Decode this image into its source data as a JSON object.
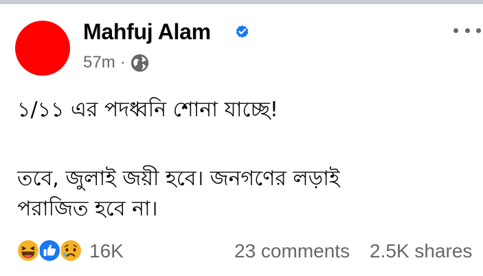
{
  "post": {
    "author": "Mahfuj Alam",
    "time": "57m",
    "separator": "·",
    "audience_icon": "globe-icon",
    "verified_icon": "verified-badge-icon",
    "more_icon": "more-options-icon",
    "lines": [
      "১/১১ এর পদধ্বনি শোনা যাচ্ছে!",
      "তবে, জুলাই জয়ী হবে। জনগণের লড়াই",
      "পরাজিত হবে না।"
    ]
  },
  "engagement": {
    "reaction_icons": [
      "haha-icon",
      "like-icon",
      "sad-icon"
    ],
    "reaction_count": "16K",
    "comments": "23 comments",
    "shares": "2.5K shares"
  },
  "colors": {
    "avatar": "#ff0000",
    "verified": "#1877f2",
    "secondary_text": "#65676b",
    "like": "#1877f2",
    "reaction_yellow": "#f7b125"
  }
}
